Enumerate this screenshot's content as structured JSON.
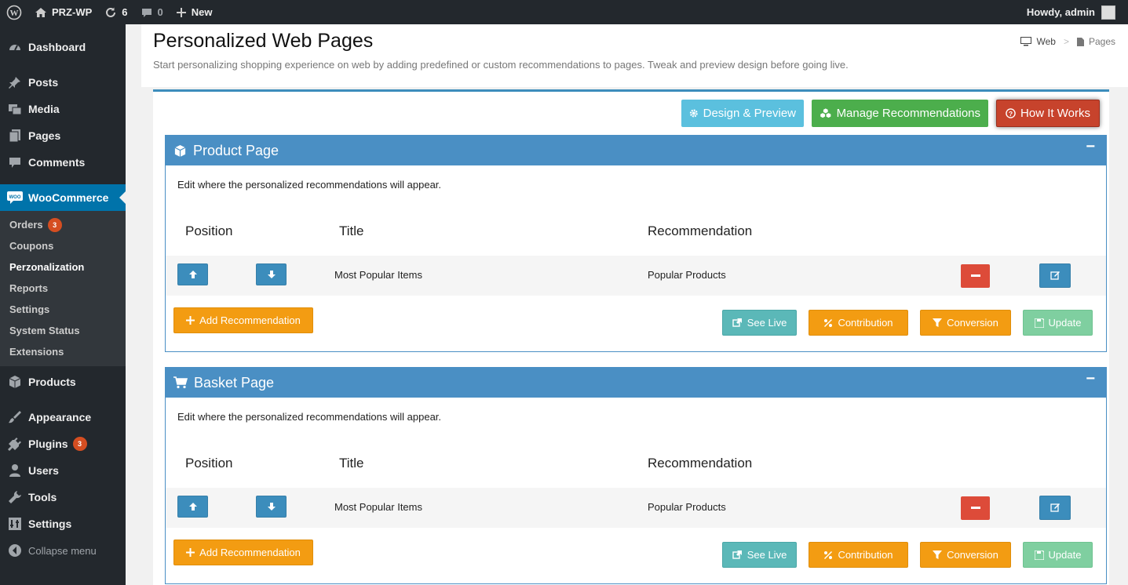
{
  "adminbar": {
    "site_name": "PRZ-WP",
    "updates_count": "6",
    "comments_count": "0",
    "new_label": "New",
    "howdy": "Howdy, admin"
  },
  "sidebar": {
    "items": [
      {
        "label": "Dashboard",
        "icon": "dashboard-icon"
      },
      {
        "label": "Posts",
        "icon": "pin-icon"
      },
      {
        "label": "Media",
        "icon": "media-icon"
      },
      {
        "label": "Pages",
        "icon": "pages-icon"
      },
      {
        "label": "Comments",
        "icon": "comment-icon"
      },
      {
        "label": "WooCommerce",
        "icon": "woo-icon"
      },
      {
        "label": "Products",
        "icon": "cube-icon"
      },
      {
        "label": "Appearance",
        "icon": "brush-icon"
      },
      {
        "label": "Plugins",
        "icon": "plug-icon",
        "badge": "3"
      },
      {
        "label": "Users",
        "icon": "user-icon"
      },
      {
        "label": "Tools",
        "icon": "wrench-icon"
      },
      {
        "label": "Settings",
        "icon": "settings-icon"
      }
    ],
    "woo_sub": [
      {
        "label": "Orders",
        "badge": "3"
      },
      {
        "label": "Coupons"
      },
      {
        "label": "Perzonalization"
      },
      {
        "label": "Reports"
      },
      {
        "label": "Settings"
      },
      {
        "label": "System Status"
      },
      {
        "label": "Extensions"
      }
    ],
    "collapse": "Collapse menu"
  },
  "header": {
    "title": "Personalized Web Pages",
    "subtitle": "Start personalizing shopping experience on web by adding predefined or custom recommendations to pages. Tweak and preview design before going live.",
    "breadcrumb_web": "Web",
    "breadcrumb_pages": "Pages"
  },
  "toolbar": {
    "design": "Design & Preview",
    "manage": "Manage Recommendations",
    "how": "How It Works"
  },
  "columns": {
    "position": "Position",
    "title": "Title",
    "recommendation": "Recommendation"
  },
  "panels": [
    {
      "title": "Product Page",
      "desc": "Edit where the personalized recommendations will appear.",
      "row": {
        "title": "Most Popular Items",
        "recommendation": "Popular Products"
      },
      "add": "Add Recommendation",
      "see_live": "See Live",
      "contribution": "Contribution",
      "conversion": "Conversion",
      "update": "Update"
    },
    {
      "title": "Basket Page",
      "desc": "Edit where the personalized recommendations will appear.",
      "row": {
        "title": "Most Popular Items",
        "recommendation": "Popular Products"
      },
      "add": "Add Recommendation",
      "see_live": "See Live",
      "contribution": "Contribution",
      "conversion": "Conversion",
      "update": "Update"
    }
  ],
  "collapse_symbol": "−",
  "colors": {
    "primary": "#3c8dbc",
    "info": "#5bc0de",
    "success": "#4cae4c",
    "danger": "#dd4b39",
    "warning": "#f39c12",
    "wp_dark": "#23282d",
    "wp_blue": "#0073aa"
  }
}
